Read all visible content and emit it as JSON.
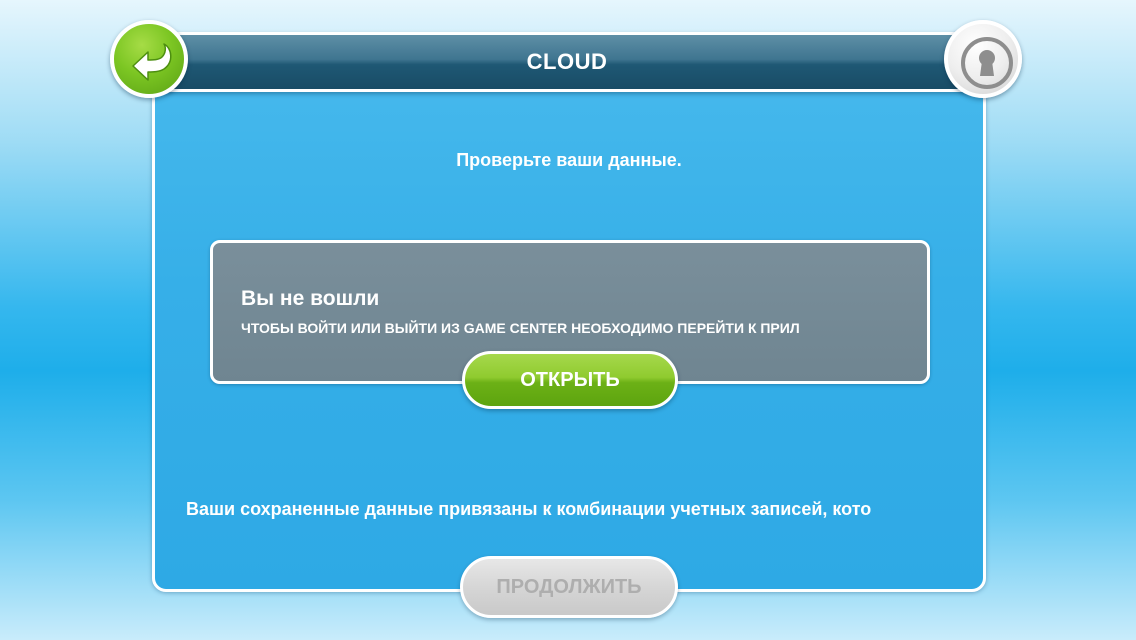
{
  "header": {
    "title": "CLOUD"
  },
  "icons": {
    "back": "back-arrow-icon",
    "lock": "keyhole-icon"
  },
  "main": {
    "check_label": "Проверьте ваши данные.",
    "info_box": {
      "title": "Вы не вошли",
      "text": "ЧТОБЫ ВОЙТИ ИЛИ ВЫЙТИ ИЗ GAME CENTER НЕОБХОДИМО ПЕРЕЙТИ К ПРИЛ"
    },
    "open_button_label": "ОТКРЫТЬ",
    "bottom_text": "Ваши сохраненные данные привязаны к комбинации учетных записей, кото",
    "continue_button_label": "ПРОДОЛЖИТЬ",
    "continue_button_enabled": false
  },
  "colors": {
    "accent_green": "#7cc623",
    "panel_blue": "#36afe8",
    "header_dark": "#1f5874",
    "info_gray": "#728794",
    "disabled_gray": "#d6d6d6"
  }
}
